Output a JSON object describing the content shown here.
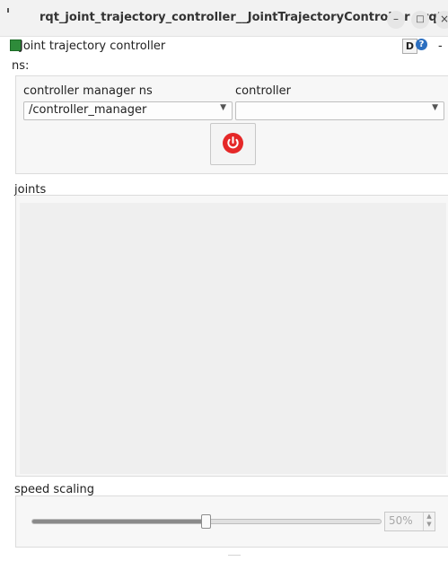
{
  "window": {
    "title": "rqt_joint_trajectory_controller__JointTrajectoryController - rqt",
    "minimize_glyph": "–",
    "maximize_glyph": "□",
    "close_glyph": "×"
  },
  "plugin": {
    "title": "Joint trajectory controller",
    "icon": "joint-trajectory-icon",
    "d_button": "D",
    "help_glyph": "?",
    "close_glyph": "-"
  },
  "ns_group": {
    "label": "ns:",
    "controller_manager_label": "controller manager ns",
    "controller_label": "controller",
    "controller_manager_value": "/controller_manager",
    "controller_value": "",
    "dropdown_glyph": "▼",
    "power_icon": "power-icon",
    "power_color": "#e52828"
  },
  "joints": {
    "label": "joints"
  },
  "speed_scaling": {
    "label": "speed scaling",
    "value": 0.5,
    "display": "50%",
    "spin_up": "▲",
    "spin_down": "▼"
  }
}
